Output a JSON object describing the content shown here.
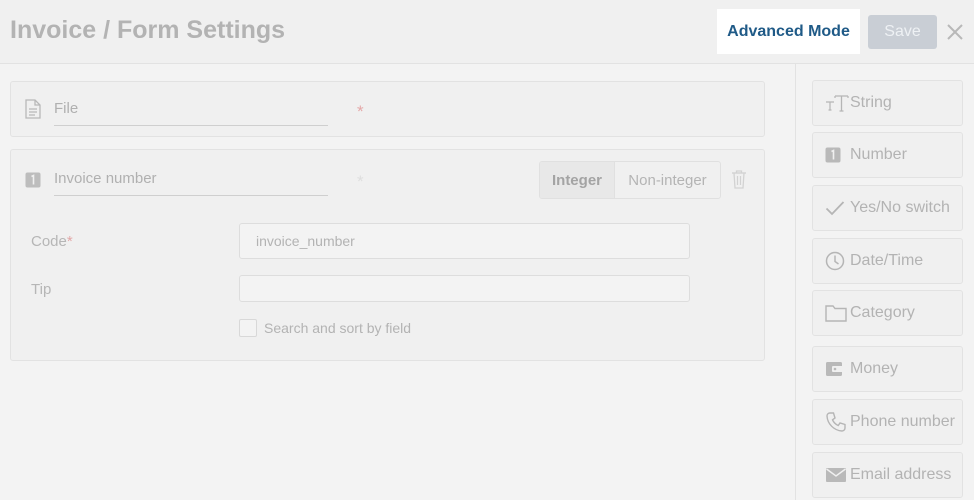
{
  "header": {
    "title": "Invoice / Form Settings",
    "advanced_label": "Advanced Mode",
    "save_label": "Save"
  },
  "fields": {
    "file": {
      "label": "File",
      "required_mark": "*"
    },
    "invoice": {
      "label": "Invoice number",
      "required_mark": "*",
      "type_options": [
        "Integer",
        "Non-integer"
      ],
      "selected_type": "Integer",
      "code_label": "Code",
      "code_required": "*",
      "code_value": "invoice_number",
      "tip_label": "Tip",
      "tip_value": "",
      "search_sort_label": "Search and sort by field",
      "search_sort_checked": false
    }
  },
  "toolbox": [
    {
      "label": "String",
      "icon": "text-icon"
    },
    {
      "label": "Number",
      "icon": "number-icon"
    },
    {
      "label": "Yes/No switch",
      "icon": "check-icon"
    },
    {
      "label": "Date/Time",
      "icon": "clock-icon"
    },
    {
      "label": "Category",
      "icon": "folder-icon"
    },
    {
      "label": "Money",
      "icon": "wallet-icon"
    },
    {
      "label": "Phone number",
      "icon": "phone-icon"
    },
    {
      "label": "Email address",
      "icon": "envelope-icon"
    }
  ],
  "colors": {
    "accent": "#1f5a87",
    "required": "#e2a7a7",
    "save_disabled": "#c9ced5"
  }
}
